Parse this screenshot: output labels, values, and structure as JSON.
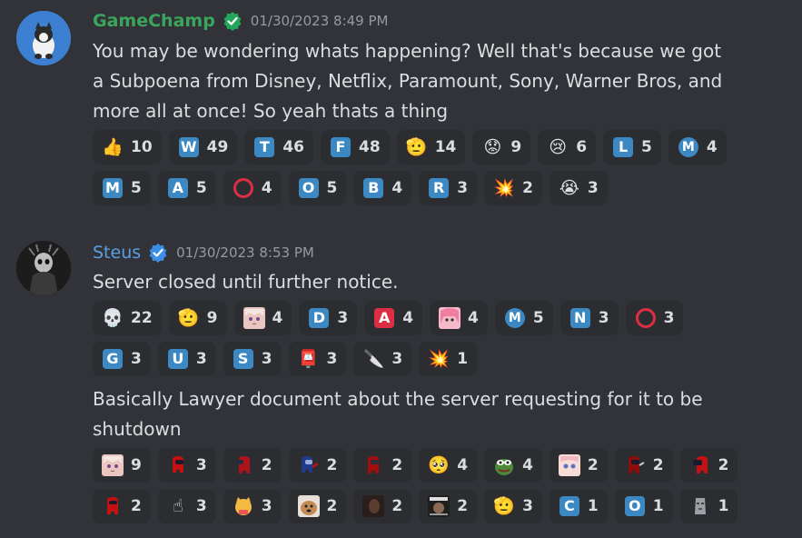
{
  "messages": [
    {
      "username": "GameChamp",
      "username_color": "#3ba55c",
      "timestamp": "01/30/2023 8:49 PM",
      "text": "You may be wondering whats happening? Well that's because we got a Subpoena from Disney, Netflix, Paramount, Sony, Warner Bros, and more all at once! So yeah thats a thing",
      "reactions": [
        {
          "icon": "thumbs-up",
          "glyph": "👍",
          "count": "10"
        },
        {
          "icon": "letter-w",
          "letter": "W",
          "count": "49"
        },
        {
          "icon": "letter-t",
          "letter": "T",
          "count": "46"
        },
        {
          "icon": "letter-f",
          "letter": "F",
          "count": "48"
        },
        {
          "icon": "saluting-face",
          "glyph": "🫡",
          "count": "14"
        },
        {
          "icon": "worried-face",
          "glyph": "😟",
          "count": "9"
        },
        {
          "icon": "crying-face",
          "glyph": "😢",
          "count": "6"
        },
        {
          "icon": "letter-l",
          "letter": "L",
          "count": "5"
        },
        {
          "icon": "circled-m",
          "letter": "M",
          "count": "4"
        },
        {
          "icon": "letter-m",
          "letter": "M",
          "count": "5"
        },
        {
          "icon": "letter-a",
          "letter": "A",
          "count": "5"
        },
        {
          "icon": "red-circle",
          "count": "4"
        },
        {
          "icon": "letter-o",
          "letter": "O",
          "count": "5"
        },
        {
          "icon": "letter-b",
          "letter": "B",
          "count": "4"
        },
        {
          "icon": "letter-r",
          "letter": "R",
          "count": "3"
        },
        {
          "icon": "explosion",
          "glyph": "💥",
          "count": "2"
        },
        {
          "icon": "loudly-crying-face",
          "glyph": "😭",
          "count": "3"
        }
      ]
    },
    {
      "username": "Steus",
      "username_color": "#5b9fe3",
      "timestamp": "01/30/2023 8:53 PM",
      "text": "Server closed until further notice.",
      "reactions": [
        {
          "icon": "skull",
          "glyph": "💀",
          "count": "22"
        },
        {
          "icon": "saluting-face",
          "glyph": "🫡",
          "count": "9"
        },
        {
          "icon": "anime-girl",
          "count": "4"
        },
        {
          "icon": "letter-d",
          "letter": "D",
          "count": "3"
        },
        {
          "icon": "letter-a-red",
          "letter": "A",
          "count": "4"
        },
        {
          "icon": "pink-hair-girl",
          "count": "4"
        },
        {
          "icon": "circled-m",
          "letter": "M",
          "count": "5"
        },
        {
          "icon": "letter-n",
          "letter": "N",
          "count": "3"
        },
        {
          "icon": "red-circle",
          "count": "3"
        },
        {
          "icon": "letter-g",
          "letter": "G",
          "count": "3"
        },
        {
          "icon": "letter-u",
          "letter": "U",
          "count": "3"
        },
        {
          "icon": "letter-s",
          "letter": "S",
          "count": "3"
        },
        {
          "icon": "postbox",
          "glyph": "📮",
          "count": "3"
        },
        {
          "icon": "knife",
          "glyph": "🔪",
          "count": "3"
        },
        {
          "icon": "explosion",
          "glyph": "💥",
          "count": "1"
        }
      ]
    },
    {
      "text": "Basically Lawyer document about the server requesting for it to be shutdown",
      "reactions": [
        {
          "icon": "anime-girl",
          "count": "9"
        },
        {
          "icon": "red-crewmate",
          "count": "3"
        },
        {
          "icon": "red-crewmate-side",
          "count": "2"
        },
        {
          "icon": "crewmate-knife",
          "count": "2"
        },
        {
          "icon": "red-crewmate-2",
          "count": "2"
        },
        {
          "icon": "pleading-face",
          "glyph": "🥺",
          "count": "4"
        },
        {
          "icon": "pepe-frog",
          "count": "4"
        },
        {
          "icon": "anime-face",
          "count": "2"
        },
        {
          "icon": "crewmate-dark",
          "count": "2"
        },
        {
          "icon": "red-crewmate-3",
          "count": "2"
        },
        {
          "icon": "red-crewmate-4",
          "count": "2"
        },
        {
          "icon": "pointing-up",
          "glyph": "☝",
          "count": "3"
        },
        {
          "icon": "cat-ok",
          "count": "3"
        },
        {
          "icon": "dog-face",
          "count": "2"
        },
        {
          "icon": "dark-photo",
          "count": "2"
        },
        {
          "icon": "meme-image",
          "count": "2"
        },
        {
          "icon": "saluting-face",
          "glyph": "🫡",
          "count": "3"
        },
        {
          "icon": "letter-c",
          "letter": "C",
          "count": "1"
        },
        {
          "icon": "letter-o",
          "letter": "O",
          "count": "1"
        },
        {
          "icon": "moai",
          "count": "1"
        }
      ]
    }
  ]
}
